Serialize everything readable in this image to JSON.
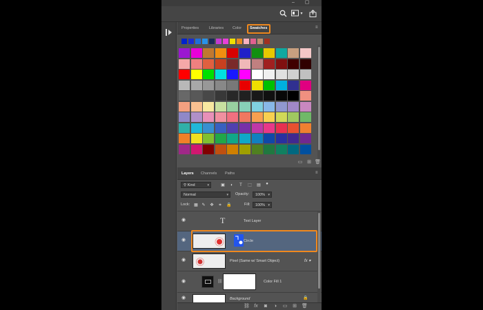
{
  "window": {
    "minimize": "–",
    "restore": "▢"
  },
  "toolbar": {
    "search_icon": "search-icon",
    "workspace_icon": "workspace-icon",
    "share_icon": "share-icon"
  },
  "swatches_panel": {
    "tabs": [
      "Properties",
      "Libraries",
      "Color",
      "Swatches"
    ],
    "active_tab": "Swatches",
    "recent_colors": [
      "#0022cc",
      "#1b2ccf",
      "#1f6fd8",
      "#2892e8",
      "#1b2a55",
      "#c23ad2",
      "#e83fd8",
      "#f0e000",
      "#e88a1e",
      "#f7b2c0",
      "#e06090",
      "#c09070",
      "#a03020"
    ],
    "grid": [
      [
        "#9b17d1",
        "#e800d8",
        "#c07830",
        "#f08e10",
        "#d80000",
        "#2020c8",
        "#109010",
        "#e8c800",
        "#10a8a0",
        "#c8a080",
        "#f4c8c8"
      ],
      [
        "#f5a8a8",
        "#f08080",
        "#e06040",
        "#c84020",
        "#7a2a2a",
        "#f0b8b8",
        "#c08080",
        "#a02020",
        "#801010",
        "#400000",
        "#300000"
      ],
      [
        "#ff0000",
        "#ffff00",
        "#00e000",
        "#00e0e0",
        "#1818ff",
        "#ff00ff",
        "#ffffff",
        "#f0f0f0",
        "#e0e0e0",
        "#d0d0d0",
        "#c0c0c0"
      ],
      [
        "#b8b8b8",
        "#a8a8a8",
        "#989898",
        "#888888",
        "#787878",
        "#e80000",
        "#f0e000",
        "#00c000",
        "#00b0e0",
        "#303090",
        "#e00080"
      ],
      [
        "#686868",
        "#585858",
        "#484848",
        "#383838",
        "#282828",
        "#202020",
        "#181818",
        "#101010",
        "#080808",
        "#000000",
        "#f09080"
      ],
      [
        "#f4a080",
        "#f8c090",
        "#f8e8a0",
        "#c8e0a0",
        "#98d0a0",
        "#88d0b8",
        "#80d0e0",
        "#88b8e8",
        "#9098d0",
        "#a088c8",
        "#c888c0"
      ],
      [
        "#9088c8",
        "#b090c8",
        "#e890b8",
        "#f090a0",
        "#f07080",
        "#f07860",
        "#f8a050",
        "#f8d050",
        "#d0d858",
        "#a0c860",
        "#70b868"
      ],
      [
        "#30b0a8",
        "#20b8d8",
        "#3890d0",
        "#3860c0",
        "#5040b0",
        "#7830a8",
        "#c038a8",
        "#e83888",
        "#e83050",
        "#e85030",
        "#f08030"
      ],
      [
        "#f08028",
        "#f0e020",
        "#80c030",
        "#20a848",
        "#10a888",
        "#10a8c8",
        "#1080c0",
        "#1048a8",
        "#2830a0",
        "#402890",
        "#702890"
      ],
      [
        "#a02888",
        "#d01870",
        "#800000",
        "#c05010",
        "#d08000",
        "#a0a000",
        "#508020",
        "#207840",
        "#108060",
        "#006880",
        "#0050a0"
      ]
    ]
  },
  "layers_panel": {
    "tabs": [
      "Layers",
      "Channels",
      "Paths"
    ],
    "active_tab": "Layers",
    "filter": {
      "kind_label": "Kind"
    },
    "blend_mode": "Normal",
    "opacity_label": "Opacity:",
    "opacity_value": "100%",
    "lock_label": "Lock:",
    "fill_label": "Fill:",
    "fill_value": "100%",
    "layers": [
      {
        "name": "Text Layer",
        "kind": "text",
        "selected": false
      },
      {
        "name": "Circle",
        "kind": "shape",
        "selected": true
      },
      {
        "name": "Pixel (Same w/ Smart Object)",
        "kind": "pixel",
        "selected": false
      },
      {
        "name": "Color Fill 1",
        "kind": "fill",
        "selected": false
      },
      {
        "name": "Background",
        "kind": "background",
        "selected": false
      }
    ],
    "footer_icons": [
      "link-icon",
      "fx-icon",
      "mask-icon",
      "adjustment-icon",
      "group-icon",
      "new-layer-icon",
      "trash-icon"
    ]
  },
  "colors": {
    "accent_highlight": "#f0891e",
    "selected_layer": "#54667f",
    "panel_bg": "#535353"
  }
}
